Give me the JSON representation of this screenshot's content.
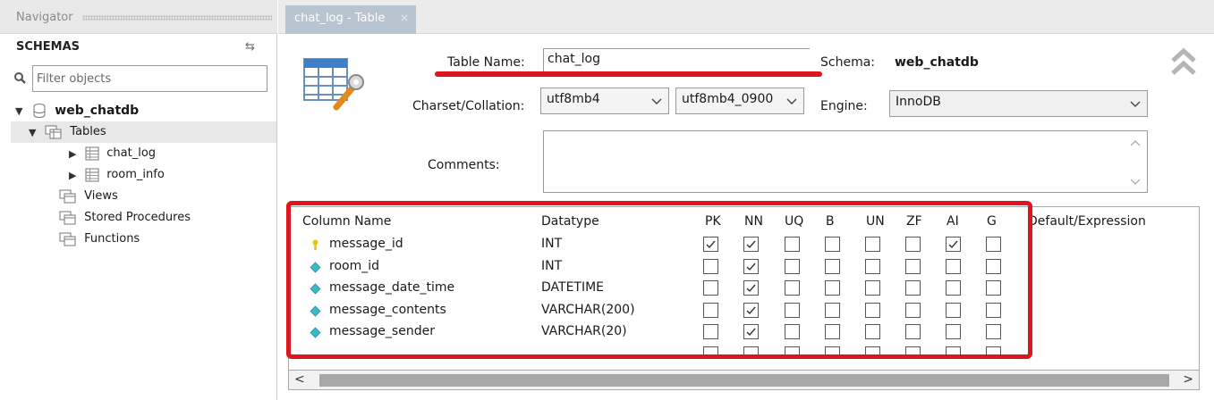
{
  "navigator": {
    "title": "Navigator",
    "schemas_label": "SCHEMAS",
    "filter_placeholder": "Filter objects",
    "tree": {
      "database": "web_chatdb",
      "tables_label": "Tables",
      "tables": [
        "chat_log",
        "room_info"
      ],
      "views_label": "Views",
      "procedures_label": "Stored Procedures",
      "functions_label": "Functions"
    }
  },
  "tab": {
    "label": "chat_log - Table",
    "close": "×"
  },
  "editor": {
    "table_name_label": "Table Name:",
    "table_name": "chat_log",
    "schema_label": "Schema:",
    "schema_value": "web_chatdb",
    "charset_label": "Charset/Collation:",
    "charset": "utf8mb4",
    "collation": "utf8mb4_0900",
    "engine_label": "Engine:",
    "engine": "InnoDB",
    "comments_label": "Comments:",
    "comments": ""
  },
  "grid": {
    "headers": {
      "column_name": "Column Name",
      "datatype": "Datatype",
      "pk": "PK",
      "nn": "NN",
      "uq": "UQ",
      "b": "B",
      "un": "UN",
      "zf": "ZF",
      "ai": "AI",
      "g": "G",
      "default": "Default/Expression"
    },
    "flag_keys": [
      "pk",
      "nn",
      "uq",
      "b",
      "un",
      "zf",
      "ai",
      "g"
    ],
    "rows": [
      {
        "name": "message_id",
        "datatype": "INT",
        "key": true,
        "flags": [
          true,
          true,
          false,
          false,
          false,
          false,
          true,
          false
        ]
      },
      {
        "name": "room_id",
        "datatype": "INT",
        "key": false,
        "flags": [
          false,
          true,
          false,
          false,
          false,
          false,
          false,
          false
        ]
      },
      {
        "name": "message_date_time",
        "datatype": "DATETIME",
        "key": false,
        "flags": [
          false,
          true,
          false,
          false,
          false,
          false,
          false,
          false
        ]
      },
      {
        "name": "message_contents",
        "datatype": "VARCHAR(200)",
        "key": false,
        "flags": [
          false,
          true,
          false,
          false,
          false,
          false,
          false,
          false
        ]
      },
      {
        "name": "message_sender",
        "datatype": "VARCHAR(20)",
        "key": false,
        "flags": [
          false,
          true,
          false,
          false,
          false,
          false,
          false,
          false
        ]
      }
    ]
  },
  "colors": {
    "highlight": "#e0141b",
    "tab_active": "#b8c4cf",
    "key_icon": "#f2c200",
    "column_icon": "#3ab8c8"
  },
  "icons": {
    "refresh": "refresh-icon",
    "search": "search-icon",
    "database": "database-icon",
    "table": "table-icon",
    "collapse": "double-chevron-up-icon"
  }
}
